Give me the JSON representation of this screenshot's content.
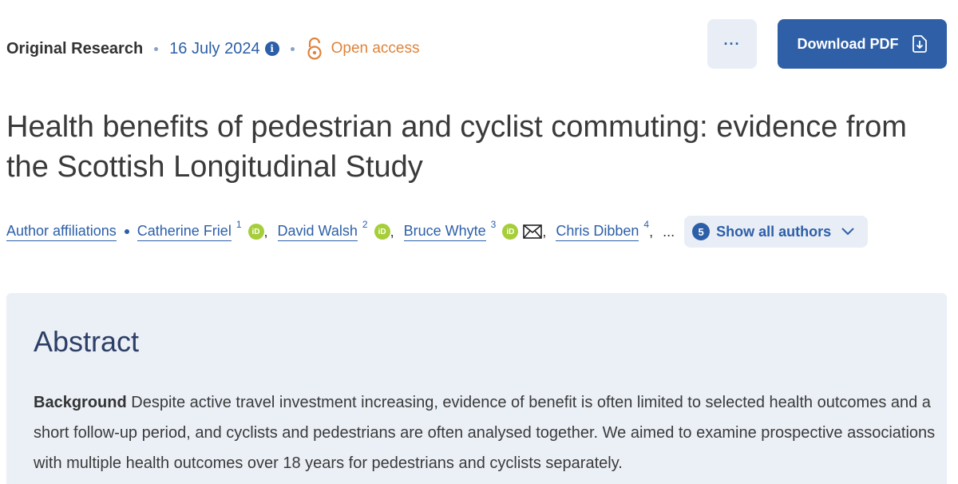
{
  "meta": {
    "article_type": "Original Research",
    "date": "16 July 2024",
    "info_icon": "info-icon",
    "open_access": "Open access"
  },
  "actions": {
    "more_label": "···",
    "download_label": "Download PDF"
  },
  "title": "Health benefits of pedestrian and cyclist commuting: evidence from the Scottish Longitudinal Study",
  "authors": {
    "affiliations_label": "Author affiliations",
    "list": [
      {
        "name": "Catherine Friel",
        "sup": "1",
        "orcid": true
      },
      {
        "name": "David Walsh",
        "sup": "2",
        "orcid": true
      },
      {
        "name": "Bruce Whyte",
        "sup": "3",
        "orcid": true,
        "email": true
      },
      {
        "name": "Chris Dibben",
        "sup": "4"
      }
    ],
    "orcid_text": "iD",
    "ellipsis": "...",
    "show_all_count": "5",
    "show_all_label": "Show all authors"
  },
  "abstract": {
    "heading": "Abstract",
    "section_label": "Background",
    "text": "Despite active travel investment increasing, evidence of benefit is often limited to selected health outcomes and a short follow-up period, and cyclists and pedestrians are often analysed together. We aimed to examine prospective associations with multiple health outcomes over 18 years for pedestrians and cyclists separately."
  },
  "colors": {
    "link_blue": "#2c5fa8",
    "button_blue": "#2f5fa6",
    "open_access_orange": "#e0833a",
    "orcid_green": "#a6ce39",
    "panel_bg": "#ebeff6"
  }
}
